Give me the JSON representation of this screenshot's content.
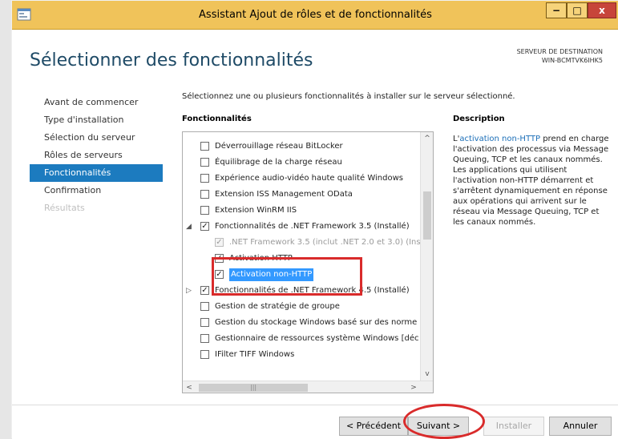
{
  "window": {
    "title": "Assistant Ajout de rôles et de fonctionnalités",
    "minimize_label": "−",
    "maximize_label": "□",
    "close_label": "x"
  },
  "page": {
    "title": "Sélectionner des fonctionnalités",
    "destination_label": "SERVEUR DE DESTINATION",
    "destination_server": "WIN-BCMTVK6IHK5"
  },
  "nav": {
    "items": [
      {
        "label": "Avant de commencer",
        "state": "normal"
      },
      {
        "label": "Type d'installation",
        "state": "normal"
      },
      {
        "label": "Sélection du serveur",
        "state": "normal"
      },
      {
        "label": "Rôles de serveurs",
        "state": "normal"
      },
      {
        "label": "Fonctionnalités",
        "state": "active"
      },
      {
        "label": "Confirmation",
        "state": "normal"
      },
      {
        "label": "Résultats",
        "state": "disabled"
      }
    ]
  },
  "main": {
    "intro": "Sélectionnez une ou plusieurs fonctionnalités à installer sur le serveur sélectionné.",
    "features_header": "Fonctionnalités",
    "description_header": "Description"
  },
  "features": [
    {
      "label": "Déverrouillage réseau BitLocker",
      "checked": false
    },
    {
      "label": "Équilibrage de la charge réseau",
      "checked": false
    },
    {
      "label": "Expérience audio-vidéo haute qualité Windows",
      "checked": false
    },
    {
      "label": "Extension ISS Management OData",
      "checked": false
    },
    {
      "label": "Extension WinRM IIS",
      "checked": false
    },
    {
      "label": "Fonctionnalités de .NET Framework 3.5 (Installé)",
      "checked": true,
      "expander": "◢"
    },
    {
      "label": ".NET Framework 3.5 (inclut .NET 2.0 et 3.0) (Ins",
      "checked": true
    },
    {
      "label": "Activation HTTP",
      "checked": true
    },
    {
      "label": "Activation non-HTTP",
      "checked": true
    },
    {
      "label": "Fonctionnalités de .NET Framework 4.5 (Installé)",
      "checked": true,
      "expander": "▷"
    },
    {
      "label": "Gestion de stratégie de groupe",
      "checked": false
    },
    {
      "label": "Gestion du stockage Windows basé sur des norme",
      "checked": false
    },
    {
      "label": "Gestionnaire de ressources système Windows [déc",
      "checked": false
    },
    {
      "label": "IFilter TIFF Windows",
      "checked": false
    }
  ],
  "description": {
    "prefix": "L'",
    "link": "activation non-HTTP",
    "body": " prend en charge l'activation des processus via Message Queuing, TCP et les canaux nommés. Les applications qui utilisent l'activation non-HTTP démarrent et s'arrêtent dynamiquement en réponse aux opérations qui arrivent sur le réseau via Message Queuing, TCP et les canaux nommés."
  },
  "buttons": {
    "previous": "< Précédent",
    "next": "Suivant >",
    "install": "Installer",
    "cancel": "Annuler"
  },
  "scroll": {
    "up": "^",
    "down": "v",
    "left": "<",
    "right": ">",
    "grip": "|||"
  },
  "colors": {
    "titlebar": "#f0c35a",
    "accent": "#1c7bbf",
    "annotation": "#d92b2b"
  }
}
